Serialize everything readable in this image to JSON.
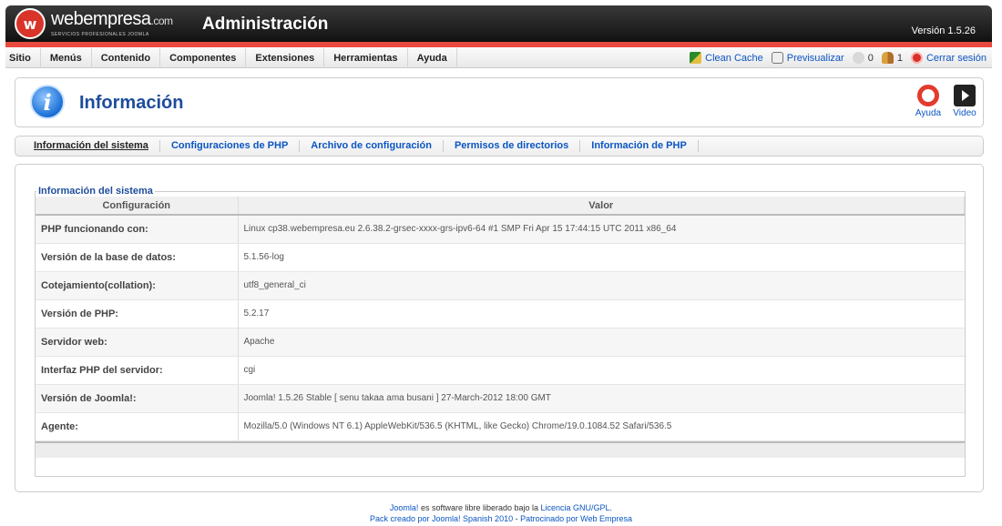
{
  "header": {
    "logo_text": "webempresa",
    "logo_suffix": ".com",
    "logo_sub": "Servicios profesionales Joomla",
    "title": "Administración",
    "version": "Versión 1.5.26"
  },
  "menu": {
    "items": [
      "Sitio",
      "Menús",
      "Contenido",
      "Componentes",
      "Extensiones",
      "Herramientas",
      "Ayuda"
    ],
    "clean_cache": "Clean Cache",
    "preview": "Previsualizar",
    "messages_count": "0",
    "users_count": "1",
    "logout": "Cerrar sesión"
  },
  "toolbar": {
    "title": "Información",
    "help_label": "Ayuda",
    "video_label": "Video"
  },
  "tabs": [
    "Información del sistema",
    "Configuraciones de PHP",
    "Archivo de configuración",
    "Permisos de directorios",
    "Información de PHP"
  ],
  "panel": {
    "legend": "Información del sistema",
    "col_config": "Configuración",
    "col_value": "Valor",
    "rows": [
      {
        "label": "PHP funcionando con:",
        "value": "Linux cp38.webempresa.eu 2.6.38.2-grsec-xxxx-grs-ipv6-64 #1 SMP Fri Apr 15 17:44:15 UTC 2011 x86_64"
      },
      {
        "label": "Versión de la base de datos:",
        "value": "5.1.56-log"
      },
      {
        "label": "Cotejamiento(collation):",
        "value": "utf8_general_ci"
      },
      {
        "label": "Versión de PHP:",
        "value": "5.2.17"
      },
      {
        "label": "Servidor web:",
        "value": "Apache"
      },
      {
        "label": "Interfaz PHP del servidor:",
        "value": "cgi"
      },
      {
        "label": "Versión de Joomla!:",
        "value": "Joomla! 1.5.26 Stable [ senu takaa ama busani ] 27-March-2012 18:00 GMT"
      },
      {
        "label": "Agente:",
        "value": "Mozilla/5.0 (Windows NT 6.1) AppleWebKit/536.5 (KHTML, like Gecko) Chrome/19.0.1084.52 Safari/536.5"
      }
    ]
  },
  "footer": {
    "line1_link1": "Joomla!",
    "line1_text": " es software libre liberado bajo la ",
    "line1_link2": "Licencia GNU/GPL",
    "line1_end": ".",
    "line2_a": "Pack creado por Joomla! Spanish 2010",
    "line2_sep": " - ",
    "line2_b": "Patrocinado por Web Empresa"
  }
}
